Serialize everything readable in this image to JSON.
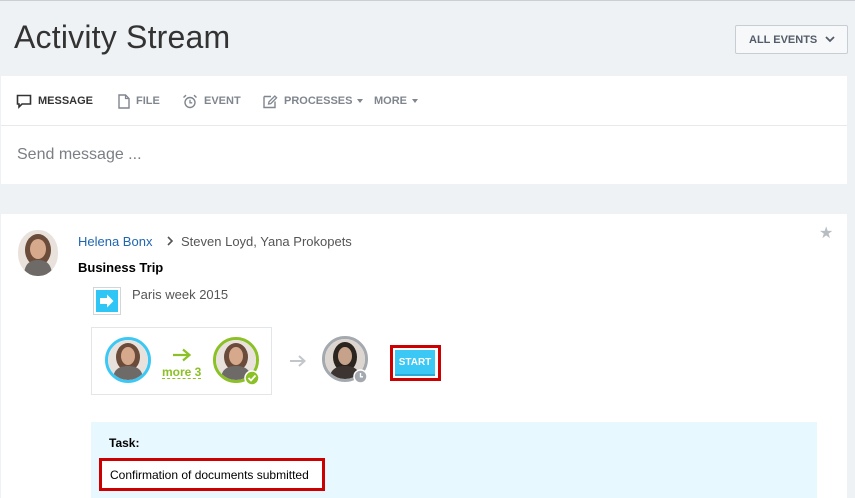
{
  "header": {
    "title": "Activity Stream",
    "events_filter": "ALL EVENTS"
  },
  "composer": {
    "tabs": [
      {
        "label": "MESSAGE",
        "icon": "message-icon",
        "active": true
      },
      {
        "label": "FILE",
        "icon": "file-icon"
      },
      {
        "label": "EVENT",
        "icon": "alarm-clock-icon"
      },
      {
        "label": "PROCESSES",
        "icon": "edit-icon",
        "dropdown": true
      },
      {
        "label": "MORE",
        "dropdown": true
      }
    ],
    "placeholder": "Send message ..."
  },
  "post": {
    "author": "Helena Bonx",
    "recipients": "Steven Loyd, Yana Prokopets",
    "title": "Business Trip",
    "process_name": "Paris week 2015",
    "workflow": {
      "more_label": "more 3",
      "start_label": "START"
    },
    "task": {
      "label": "Task:",
      "text": "Confirmation of documents submitted"
    }
  },
  "colors": {
    "accent_blue": "#3bc8f5",
    "link_blue": "#2067b0",
    "success_green": "#8bc126",
    "highlight_red": "#cc0000",
    "task_bg": "#e7f8fe"
  }
}
